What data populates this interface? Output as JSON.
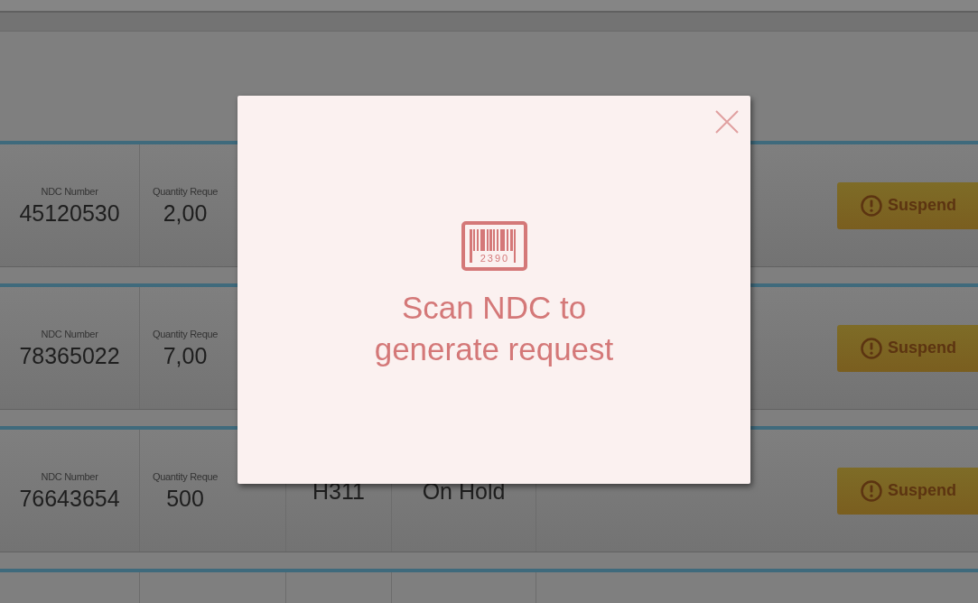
{
  "rows": [
    {
      "cells": [
        {
          "label": "NDC Number",
          "value": "45120530"
        },
        {
          "label": "Quantity Reque",
          "value": "2,00"
        }
      ],
      "action": "Suspend"
    },
    {
      "cells": [
        {
          "label": "NDC Number",
          "value": "78365022"
        },
        {
          "label": "Quantity Reque",
          "value": "7,00"
        }
      ],
      "action": "Suspend"
    },
    {
      "cells": [
        {
          "label": "NDC Number",
          "value": "76643654"
        },
        {
          "label": "Quantity Reque",
          "value": "500"
        },
        {
          "value": "H311"
        },
        {
          "value": "On Hold"
        }
      ],
      "action": "Suspend"
    }
  ],
  "modal": {
    "barcode_digits": "2390",
    "message": "Scan NDC to generate request"
  }
}
